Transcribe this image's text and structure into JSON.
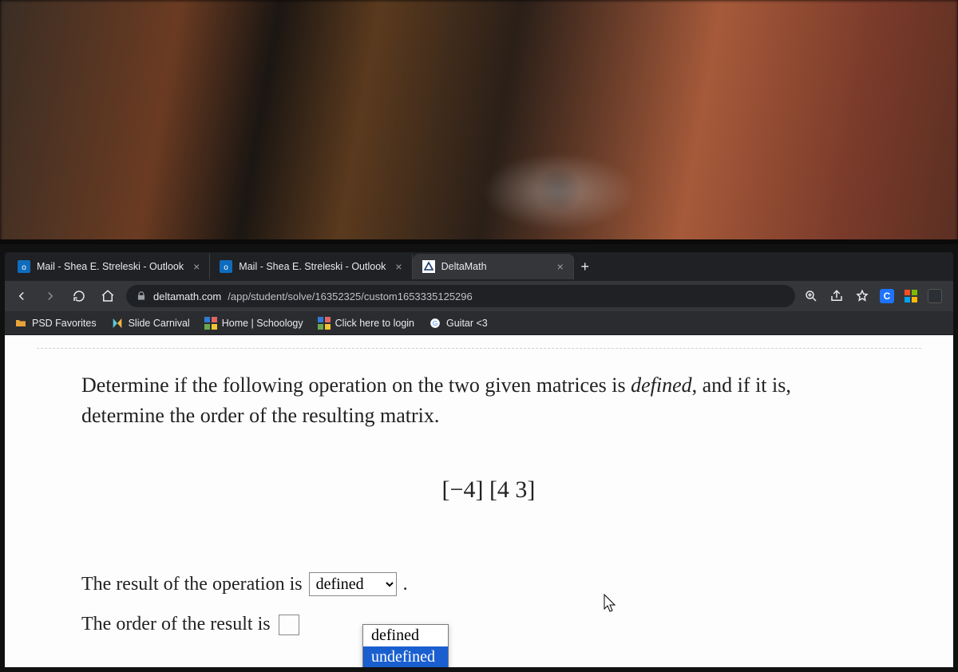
{
  "tabs": [
    {
      "label": "Mail - Shea E. Streleski - Outlook",
      "icon": "outlook"
    },
    {
      "label": "Mail - Shea E. Streleski - Outlook",
      "icon": "outlook"
    },
    {
      "label": "DeltaMath",
      "icon": "deltamath",
      "active": true
    }
  ],
  "tab_close": "×",
  "newtab": "+",
  "url": {
    "domain": "deltamath.com",
    "path": "/app/student/solve/16352325/custom1653335125296"
  },
  "bookmarks": [
    {
      "label": "PSD Favorites",
      "icon": "folder-orange"
    },
    {
      "label": "Slide Carnival",
      "icon": "slides"
    },
    {
      "label": "Home | Schoology",
      "icon": "grid"
    },
    {
      "label": "Click here to login",
      "icon": "grid"
    },
    {
      "label": "Guitar <3",
      "icon": "google"
    }
  ],
  "problem": {
    "line1_a": "Determine if the following operation on the two given matrices is ",
    "line1_em": "defined",
    "line1_b": ", and if it is,",
    "line2": "determine the order of the resulting matrix.",
    "matrix": "[−4] [4   3]",
    "answer_label": "The result of the operation is",
    "answer_period": ".",
    "order_label": "The order of the result is",
    "select_value": "defined",
    "options": [
      "defined",
      "undefined"
    ],
    "highlighted_option": "undefined"
  }
}
